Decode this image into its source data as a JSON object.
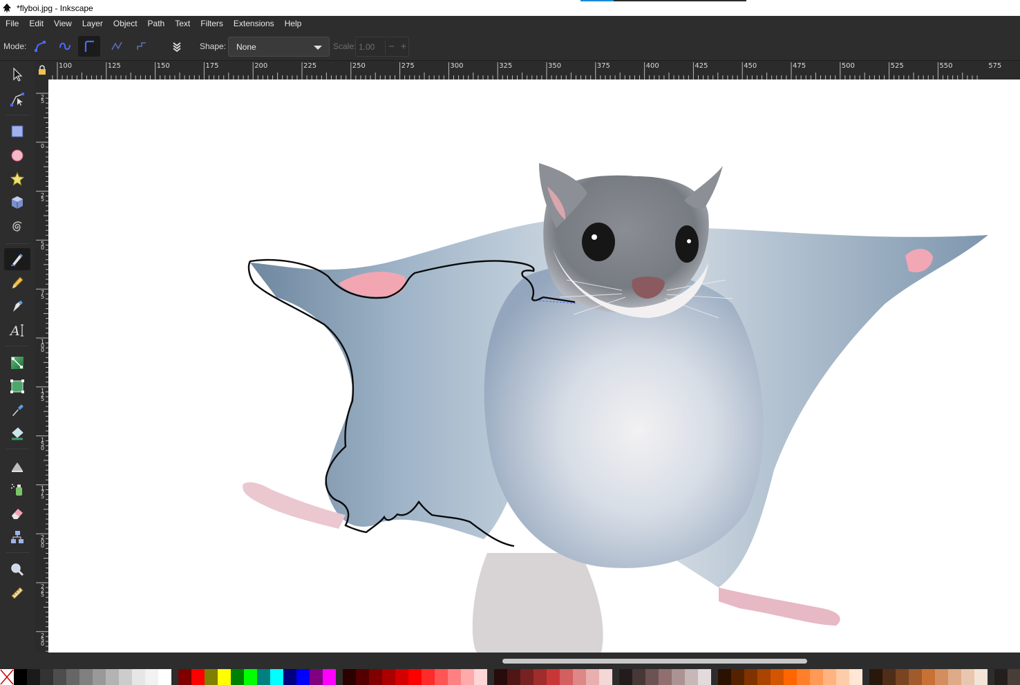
{
  "window": {
    "title": "*flyboi.jpg - Inkscape"
  },
  "menu": [
    "File",
    "Edit",
    "View",
    "Layer",
    "Object",
    "Path",
    "Text",
    "Filters",
    "Extensions",
    "Help"
  ],
  "toolbar": {
    "mode_label": "Mode:",
    "shape_label": "Shape:",
    "shape_value": "None",
    "scale_label": "Scale:",
    "scale_value": "1.00",
    "scale_minus": "−",
    "scale_plus": "+"
  },
  "ruler": {
    "horizontal_labels": [
      "100",
      "125",
      "150",
      "175",
      "200",
      "225",
      "250",
      "275",
      "300",
      "325",
      "350",
      "375",
      "400",
      "425",
      "450",
      "475",
      "500",
      "525",
      "550",
      "575"
    ],
    "vertical_labels": [
      "25",
      "0",
      "25",
      "50",
      "75",
      "100",
      "125",
      "150",
      "175",
      "200",
      "225",
      "250"
    ]
  },
  "palette": {
    "grays": [
      "#000000",
      "#1a1a1a",
      "#333333",
      "#4d4d4d",
      "#666666",
      "#808080",
      "#999999",
      "#b3b3b3",
      "#cccccc",
      "#e6e6e6",
      "#f2f2f2",
      "#ffffff"
    ],
    "basic": [
      "#800000",
      "#ff0000",
      "#808000",
      "#ffff00",
      "#008000",
      "#00ff00",
      "#008080",
      "#00ffff",
      "#000080",
      "#0000ff",
      "#800080",
      "#ff00ff"
    ],
    "reds": [
      "#2b0000",
      "#550000",
      "#800000",
      "#aa0000",
      "#d40000",
      "#ff0000",
      "#ff2a2a",
      "#ff5555",
      "#ff8080",
      "#ffaaaa",
      "#ffd5d5"
    ],
    "rosy": [
      "#280b0b",
      "#501616",
      "#782121",
      "#a02c2c",
      "#c83737",
      "#d35f5f",
      "#de8787",
      "#e9afaf",
      "#f4d7d7"
    ],
    "mauves": [
      "#241c1c",
      "#483737",
      "#6c5353",
      "#916f6f",
      "#ac9393",
      "#c8b7b7",
      "#e3dbdb"
    ],
    "oranges": [
      "#2b1100",
      "#552200",
      "#803300",
      "#aa4400",
      "#d45500",
      "#ff6600",
      "#ff7f2a",
      "#ff9955",
      "#ffb380",
      "#ffccaa",
      "#ffe6d5"
    ],
    "browns": [
      "#28170b",
      "#502d16",
      "#784421",
      "#a05a2c",
      "#c87137",
      "#d38d5f",
      "#deaa87",
      "#e9c6af",
      "#f4e3d7"
    ],
    "taupes": [
      "#241f1c",
      "#483e37",
      "#6c5d53",
      "#917c6f"
    ]
  }
}
